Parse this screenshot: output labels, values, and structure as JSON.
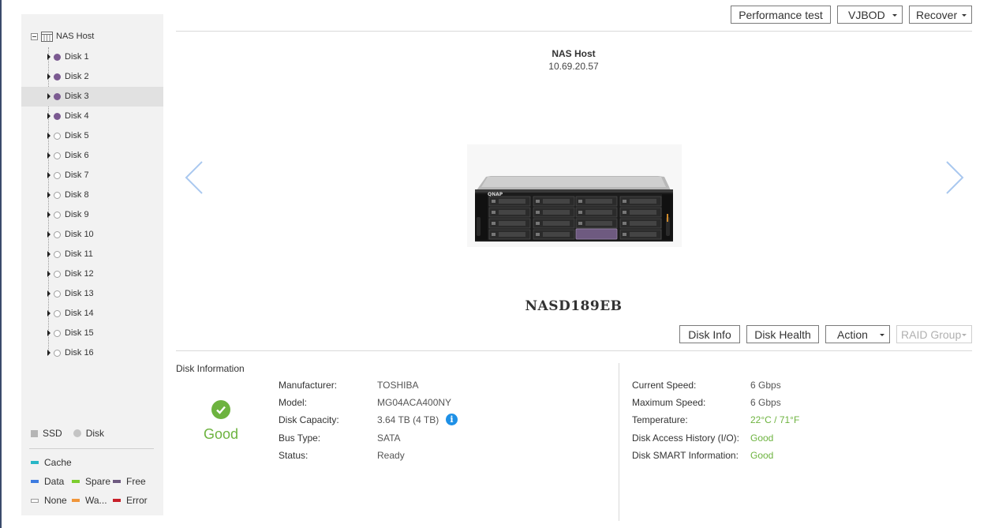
{
  "sidebar": {
    "root_label": "NAS Host",
    "disks": [
      {
        "label": "Disk 1",
        "status": "used"
      },
      {
        "label": "Disk 2",
        "status": "used"
      },
      {
        "label": "Disk 3",
        "status": "used",
        "selected": true
      },
      {
        "label": "Disk 4",
        "status": "used"
      },
      {
        "label": "Disk 5",
        "status": "empty"
      },
      {
        "label": "Disk 6",
        "status": "empty"
      },
      {
        "label": "Disk 7",
        "status": "empty"
      },
      {
        "label": "Disk 8",
        "status": "empty"
      },
      {
        "label": "Disk 9",
        "status": "empty"
      },
      {
        "label": "Disk 10",
        "status": "empty"
      },
      {
        "label": "Disk 11",
        "status": "empty"
      },
      {
        "label": "Disk 12",
        "status": "empty"
      },
      {
        "label": "Disk 13",
        "status": "empty"
      },
      {
        "label": "Disk 14",
        "status": "empty"
      },
      {
        "label": "Disk 15",
        "status": "empty"
      },
      {
        "label": "Disk 16",
        "status": "empty"
      }
    ],
    "legend": {
      "ssd": "SSD",
      "disk": "Disk",
      "cache": "Cache",
      "data": "Data",
      "spare": "Spare",
      "free": "Free",
      "none": "None",
      "warning": "Wa...",
      "error": "Error"
    }
  },
  "toolbar": {
    "performance_test": "Performance test",
    "vjbod": "VJBOD",
    "recover": "Recover"
  },
  "host": {
    "name": "NAS Host",
    "ip": "10.69.20.57",
    "model": "NASD189EB"
  },
  "disk_toolbar": {
    "disk_info": "Disk Info",
    "disk_health": "Disk Health",
    "action": "Action",
    "raid_group": "RAID Group"
  },
  "disk_info": {
    "title": "Disk Information",
    "health": "Good",
    "left": [
      {
        "label": "Manufacturer:",
        "value": "TOSHIBA"
      },
      {
        "label": "Model:",
        "value": "MG04ACA400NY"
      },
      {
        "label": "Disk Capacity:",
        "value": "3.64 TB (4 TB)"
      },
      {
        "label": "Bus Type:",
        "value": "SATA"
      },
      {
        "label": "Status:",
        "value": "Ready"
      }
    ],
    "right": [
      {
        "label": "Current Speed:",
        "value": "6 Gbps"
      },
      {
        "label": "Maximum Speed:",
        "value": "6 Gbps"
      },
      {
        "label": "Temperature:",
        "value": "22°C / 71°F"
      },
      {
        "label": "Disk Access History (I/O):",
        "value": "Good"
      },
      {
        "label": "Disk SMART Information:",
        "value": "Good"
      }
    ]
  },
  "colors": {
    "accent_green": "#6db33f",
    "disk_used": "#7b5a91",
    "info_blue": "#1e90e6",
    "legend_cache": "#29b6c6",
    "legend_data": "#3d7be0",
    "legend_spare": "#7ccd2e",
    "legend_free": "#6e5a80",
    "legend_warning": "#f0963a",
    "legend_error": "#c8202a"
  }
}
